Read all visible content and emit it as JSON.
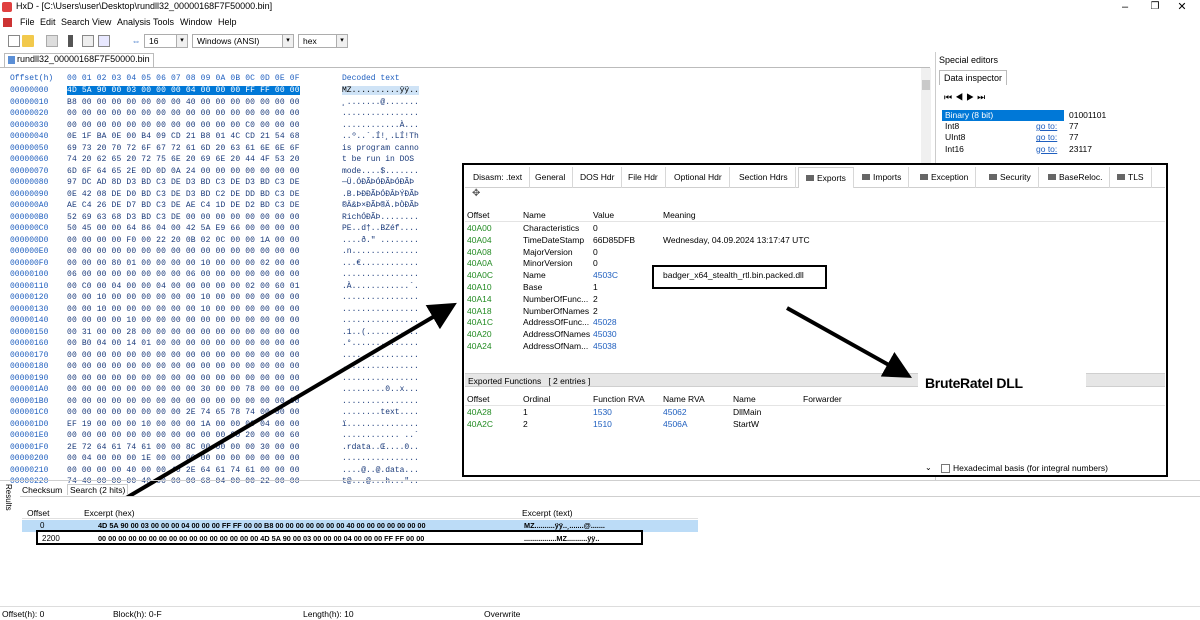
{
  "window": {
    "title": "HxD - [C:\\Users\\user\\Desktop\\rundll32_00000168F7F50000.bin]",
    "controls": [
      "–",
      "❐",
      "✕"
    ]
  },
  "menu": [
    "File",
    "Edit",
    "Search",
    "View",
    "Analysis",
    "Tools",
    "Window",
    "Help"
  ],
  "toolbar": {
    "bytes_per_row": "16",
    "charset": "Windows (ANSI)",
    "display_mode": "hex"
  },
  "file_tab": "rundll32_00000168F7F50000.bin",
  "hex_view": {
    "header_offset": "Offset(h)",
    "header_columns": "00 01 02 03 04 05 06 07 08 09 0A 0B 0C 0D 0E 0F",
    "header_decoded": "Decoded text",
    "rows": [
      {
        "offset": "00000000",
        "hex": "4D 5A 90 00 03 00 00 00 04 00 00 00 FF FF 00 00",
        "text": "MZ..........ÿÿ.."
      },
      {
        "offset": "00000010",
        "hex": "B8 00 00 00 00 00 00 00 40 00 00 00 00 00 00 00",
        "text": "¸.......@......."
      },
      {
        "offset": "00000020",
        "hex": "00 00 00 00 00 00 00 00 00 00 00 00 00 00 00 00",
        "text": "................"
      },
      {
        "offset": "00000030",
        "hex": "00 00 00 00 00 00 00 00 00 00 00 00 C0 00 00 00",
        "text": "............À..."
      },
      {
        "offset": "00000040",
        "hex": "0E 1F BA 0E 00 B4 09 CD 21 B8 01 4C CD 21 54 68",
        "text": "..º..´.Í!¸.LÍ!Th"
      },
      {
        "offset": "00000050",
        "hex": "69 73 20 70 72 6F 67 72 61 6D 20 63 61 6E 6E 6F",
        "text": "is program canno"
      },
      {
        "offset": "00000060",
        "hex": "74 20 62 65 20 72 75 6E 20 69 6E 20 44 4F 53 20",
        "text": "t be run in DOS "
      },
      {
        "offset": "00000070",
        "hex": "6D 6F 64 65 2E 0D 0D 0A 24 00 00 00 00 00 00 00",
        "text": "mode....$......."
      },
      {
        "offset": "00000080",
        "hex": "97 DC AD 8D D3 BD C3 DE D3 BD C3 DE D3 BD C3 DE",
        "text": "—Ü.ÓĐÃÞÓĐÃÞÓĐÃÞ"
      },
      {
        "offset": "00000090",
        "hex": "0E 42 08 DE D0 BD C3 DE D3 BD C2 DE DD BD C3 DE",
        "text": ".B.ÞÐĐÃÞÓĐÂÞÝĐÃÞ"
      },
      {
        "offset": "000000A0",
        "hex": "AE C4 26 DE D7 BD C3 DE AE C4 1D DE D2 BD C3 DE",
        "text": "®Ä&Þ×ĐÃÞ®Ä.ÞÒĐÃÞ"
      },
      {
        "offset": "000000B0",
        "hex": "52 69 63 68 D3 BD C3 DE 00 00 00 00 00 00 00 00",
        "text": "RichÓĐÃÞ........"
      },
      {
        "offset": "000000C0",
        "hex": "50 45 00 00 64 86 04 00 42 5A E9 66 00 00 00 00",
        "text": "PE..d†..BZéf...."
      },
      {
        "offset": "000000D0",
        "hex": "00 00 00 00 F0 00 22 20 0B 02 0C 00 00 1A 00 00",
        "text": "....ð.\" ........"
      },
      {
        "offset": "000000E0",
        "hex": "00 00 00 00 00 00 00 00 00 00 00 00 00 00 00 00",
        "text": ".n.............."
      },
      {
        "offset": "000000F0",
        "hex": "00 00 00 80 01 00 00 00 00 10 00 00 00 02 00 00",
        "text": "...€............"
      },
      {
        "offset": "00000100",
        "hex": "06 00 00 00 00 00 00 00 06 00 00 00 00 00 00 00",
        "text": "................"
      },
      {
        "offset": "00000110",
        "hex": "00 C0 00 04 00 00 04 00 00 00 00 00 02 00 60 01",
        "text": ".À............`."
      },
      {
        "offset": "00000120",
        "hex": "00 00 10 00 00 00 00 00 00 10 00 00 00 00 00 00",
        "text": "................"
      },
      {
        "offset": "00000130",
        "hex": "00 00 10 00 00 00 00 00 00 10 00 00 00 00 00 00",
        "text": "................"
      },
      {
        "offset": "00000140",
        "hex": "00 00 00 00 10 00 00 00 00 00 00 00 00 00 00 00",
        "text": "................"
      },
      {
        "offset": "00000150",
        "hex": "00 31 00 00 28 00 00 00 00 00 00 00 00 00 00 00",
        "text": ".1..(..........."
      },
      {
        "offset": "00000160",
        "hex": "00 B0 04 00 14 01 00 00 00 00 00 00 00 00 00 00",
        "text": ".°.............."
      },
      {
        "offset": "00000170",
        "hex": "00 00 00 00 00 00 00 00 00 00 00 00 00 00 00 00",
        "text": "................"
      },
      {
        "offset": "00000180",
        "hex": "00 00 00 00 00 00 00 00 00 00 00 00 00 00 00 00",
        "text": "................"
      },
      {
        "offset": "00000190",
        "hex": "00 00 00 00 00 00 00 00 00 00 00 00 00 00 00 00",
        "text": "................"
      },
      {
        "offset": "000001A0",
        "hex": "00 00 00 00 00 00 00 00 00 30 00 00 78 00 00 00",
        "text": ".........0..x..."
      },
      {
        "offset": "000001B0",
        "hex": "00 00 00 00 00 00 00 00 00 00 00 00 00 00 00 00",
        "text": "................"
      },
      {
        "offset": "000001C0",
        "hex": "00 00 00 00 00 00 00 00 2E 74 65 78 74 00 00 00",
        "text": "........text...."
      },
      {
        "offset": "000001D0",
        "hex": "EF 19 00 00 00 10 00 00 00 1A 00 00 00 04 00 00",
        "text": "ï..............."
      },
      {
        "offset": "000001E0",
        "hex": "00 00 00 00 00 00 00 00 00 00 00 00 20 00 00 60",
        "text": "............ ..`"
      },
      {
        "offset": "000001F0",
        "hex": "2E 72 64 61 74 61 00 00 8C 00 00 00 00 30 00 00",
        "text": ".rdata..Œ....0.."
      },
      {
        "offset": "00000200",
        "hex": "00 04 00 00 00 1E 00 00 00 00 00 00 00 00 00 00",
        "text": "................"
      },
      {
        "offset": "00000210",
        "hex": "00 00 00 00 40 00 00 40 2E 64 61 74 61 00 00 00",
        "text": "....@..@.data..."
      },
      {
        "offset": "00000220",
        "hex": "74 40 00 00 00 40 00 00 00 68 04 00 00 22 00 00",
        "text": "t@...@...h...\".."
      }
    ]
  },
  "special_editors": {
    "title": "Special editors",
    "tab": "Data inspector",
    "rows": [
      {
        "label": "Binary (8 bit)",
        "goto": "",
        "value": "01001101"
      },
      {
        "label": "Int8",
        "goto": "go to:",
        "value": "77"
      },
      {
        "label": "UInt8",
        "goto": "go to:",
        "value": "77"
      },
      {
        "label": "Int16",
        "goto": "go to:",
        "value": "23117"
      }
    ],
    "hex_basis_label": "Hexadecimal basis (for integral numbers)"
  },
  "pe_viewer": {
    "tabs": [
      "Disasm: .text",
      "General",
      "DOS Hdr",
      "File Hdr",
      "Optional Hdr",
      "Section Hdrs",
      "Exports",
      "Imports",
      "Exception",
      "Security",
      "BaseReloc.",
      "TLS"
    ],
    "active_tab": "Exports",
    "headers": {
      "offset": "Offset",
      "name": "Name",
      "value": "Value",
      "meaning": "Meaning"
    },
    "rows": [
      {
        "offset": "40A00",
        "name": "Characteristics",
        "value": "0",
        "meaning": "",
        "link": false
      },
      {
        "offset": "40A04",
        "name": "TimeDateStamp",
        "value": "66D85DFB",
        "meaning": "Wednesday, 04.09.2024 13:17:47 UTC",
        "link": false
      },
      {
        "offset": "40A08",
        "name": "MajorVersion",
        "value": "0",
        "meaning": "",
        "link": false
      },
      {
        "offset": "40A0A",
        "name": "MinorVersion",
        "value": "0",
        "meaning": "",
        "link": false
      },
      {
        "offset": "40A0C",
        "name": "Name",
        "value": "4503C",
        "meaning": "badger_x64_stealth_rtl.bin.packed.dll",
        "link": true
      },
      {
        "offset": "40A10",
        "name": "Base",
        "value": "1",
        "meaning": "",
        "link": false
      },
      {
        "offset": "40A14",
        "name": "NumberOfFunc...",
        "value": "2",
        "meaning": "",
        "link": false
      },
      {
        "offset": "40A18",
        "name": "NumberOfNames",
        "value": "2",
        "meaning": "",
        "link": false
      },
      {
        "offset": "40A1C",
        "name": "AddressOfFunc...",
        "value": "45028",
        "meaning": "",
        "link": true
      },
      {
        "offset": "40A20",
        "name": "AddressOfNames",
        "value": "45030",
        "meaning": "",
        "link": true
      },
      {
        "offset": "40A24",
        "name": "AddressOfNam...",
        "value": "45038",
        "meaning": "",
        "link": true
      }
    ],
    "exported_title": "Exported Functions   [ 2 entries ]",
    "exp_headers": {
      "offset": "Offset",
      "ordinal": "Ordinal",
      "rva": "Function RVA",
      "name_rva": "Name RVA",
      "name": "Name",
      "forwarder": "Forwarder"
    },
    "exports": [
      {
        "offset": "40A28",
        "ordinal": "1",
        "rva": "1530",
        "name_rva": "45062",
        "name": "DllMain",
        "forwarder": ""
      },
      {
        "offset": "40A2C",
        "ordinal": "2",
        "rva": "1510",
        "name_rva": "4506A",
        "name": "StartW",
        "forwarder": ""
      }
    ]
  },
  "annotation": "BruteRatel DLL",
  "results": {
    "side_label": "Results",
    "tabs": [
      "Checksum",
      "Search (2 hits)"
    ],
    "headers": {
      "offset": "Offset",
      "hex": "Excerpt (hex)",
      "text": "Excerpt (text)"
    },
    "rows": [
      {
        "offset": "0",
        "hex": "4D 5A 90 00 03 00 00 00 04 00 00 00 FF FF 00 00 B8 00 00 00 00 00 00 00 40 00 00 00 00 00 00 00",
        "text": "MZ..........ÿÿ..¸.......@......."
      },
      {
        "offset": "2200",
        "hex": "00 00 00 00 00 00 00 00 00 00 00 00 00 00 00 00 4D 5A 90 00 03 00 00 00 04 00 00 00 FF FF 00 00",
        "text": "................MZ..........ÿÿ.."
      }
    ]
  },
  "status_bar": {
    "offset": "Offset(h): 0",
    "block": "Block(h): 0-F",
    "length": "Length(h): 10",
    "mode": "Overwrite"
  }
}
